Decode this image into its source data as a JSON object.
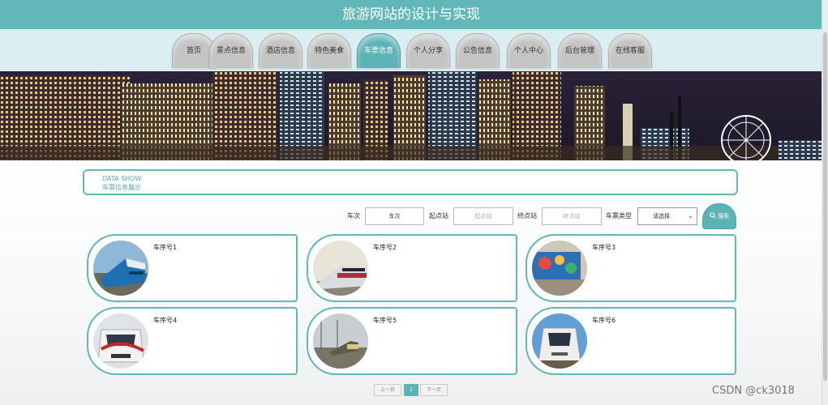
{
  "site_title": "旅游网站的设计与实现",
  "nav": {
    "items": [
      "首页",
      "景点信息",
      "酒店信息",
      "特色美食",
      "车票信息",
      "个人分享",
      "公告信息",
      "个人中心",
      "后台管理",
      "在线客服"
    ],
    "active_index": 4
  },
  "section": {
    "title_en": "DATA SHOW",
    "title_cn": "车票信息展示"
  },
  "search": {
    "train_no_label": "车次",
    "train_no_value": "车次",
    "start_label": "起点站",
    "start_placeholder": "起点站",
    "end_label": "终点站",
    "end_placeholder": "终点站",
    "type_label": "车票类型",
    "type_selected": "请选择",
    "button_label": "搜索",
    "search_icon": "search-icon"
  },
  "cards": [
    {
      "label": "车序号1",
      "image": "train-photo-1"
    },
    {
      "label": "车序号2",
      "image": "train-photo-2"
    },
    {
      "label": "车序号3",
      "image": "train-photo-3"
    },
    {
      "label": "车序号4",
      "image": "train-photo-4"
    },
    {
      "label": "车序号5",
      "image": "train-photo-5"
    },
    {
      "label": "车序号6",
      "image": "train-photo-6"
    }
  ],
  "pagination": {
    "prev_label": "上一页",
    "current_page": "1",
    "next_label": "下一页"
  },
  "watermark": "CSDN @ck3018",
  "colors": {
    "accent": "#62b8b8",
    "nav_tab": "#c4c4c4",
    "nav_bg": "#dbeef2"
  }
}
